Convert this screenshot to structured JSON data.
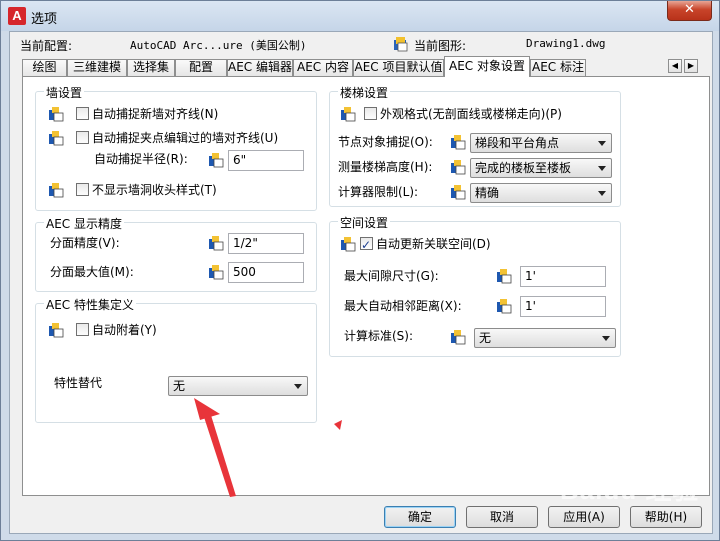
{
  "window": {
    "title": "选项",
    "close_glyph": "✕",
    "app_icon_letter": "A"
  },
  "header": {
    "profile_label": "当前配置:",
    "profile_value": "AutoCAD Arc...ure (美国公制)",
    "drawing_label": "当前图形:",
    "drawing_value": "Drawing1.dwg"
  },
  "tabs": [
    {
      "label": "绘图"
    },
    {
      "label": "三维建模"
    },
    {
      "label": "选择集"
    },
    {
      "label": "配置"
    },
    {
      "label": "AEC 编辑器"
    },
    {
      "label": "AEC 内容"
    },
    {
      "label": "AEC 项目默认值"
    },
    {
      "label": "AEC 对象设置",
      "active": true
    },
    {
      "label": "AEC 标注"
    }
  ],
  "tab_scroll": {
    "left": "◀",
    "right": "▶"
  },
  "wall": {
    "title": "墙设置",
    "auto_snap": {
      "label": "自动捕捉新墙对齐线(N)",
      "checked": false
    },
    "snap_grip": {
      "label": "自动捕捉夹点编辑过的墙对齐线(U)",
      "checked": false
    },
    "radius_label": "自动捕捉半径(R):",
    "radius_value": "6\"",
    "no_cleanup": {
      "label": "不显示墙洞收头样式(T)",
      "checked": false
    }
  },
  "precision": {
    "title": "AEC 显示精度",
    "facet_label": "分面精度(V):",
    "facet_value": "1/2\"",
    "facet_max_label": "分面最大值(M):",
    "facet_max_value": "500"
  },
  "propset": {
    "title": "AEC 特性集定义",
    "auto_attach": {
      "label": "自动附着(Y)",
      "checked": false
    },
    "override_label": "特性替代",
    "override_value": "无"
  },
  "stair": {
    "title": "楼梯设置",
    "presentation": {
      "label": "外观格式(无剖面线或楼梯走向)(P)",
      "checked": false
    },
    "node_snap_label": "节点对象捕捉(O):",
    "node_snap_value": "梯段和平台角点",
    "measure_label": "测量楼梯高度(H):",
    "measure_value": "完成的楼板至楼板",
    "calc_label": "计算器限制(L):",
    "calc_value": "精确"
  },
  "space": {
    "title": "空间设置",
    "auto_update": {
      "label": "自动更新关联空间(D)",
      "checked": true
    },
    "max_gap_label": "最大间隙尺寸(G):",
    "max_gap_value": "1'",
    "max_adj_label": "最大自动相邻距离(X):",
    "max_adj_value": "1'",
    "calc_std_label": "计算标准(S):",
    "calc_std_value": "无"
  },
  "buttons": {
    "ok": "确定",
    "cancel": "取消",
    "apply": "应用(A)",
    "help": "帮助(H)"
  },
  "watermark": "Baidu 经验",
  "colors": {
    "accent_arrow": "#e8343a",
    "titlebar": "#c5d5e8",
    "close": "#c8442a"
  }
}
